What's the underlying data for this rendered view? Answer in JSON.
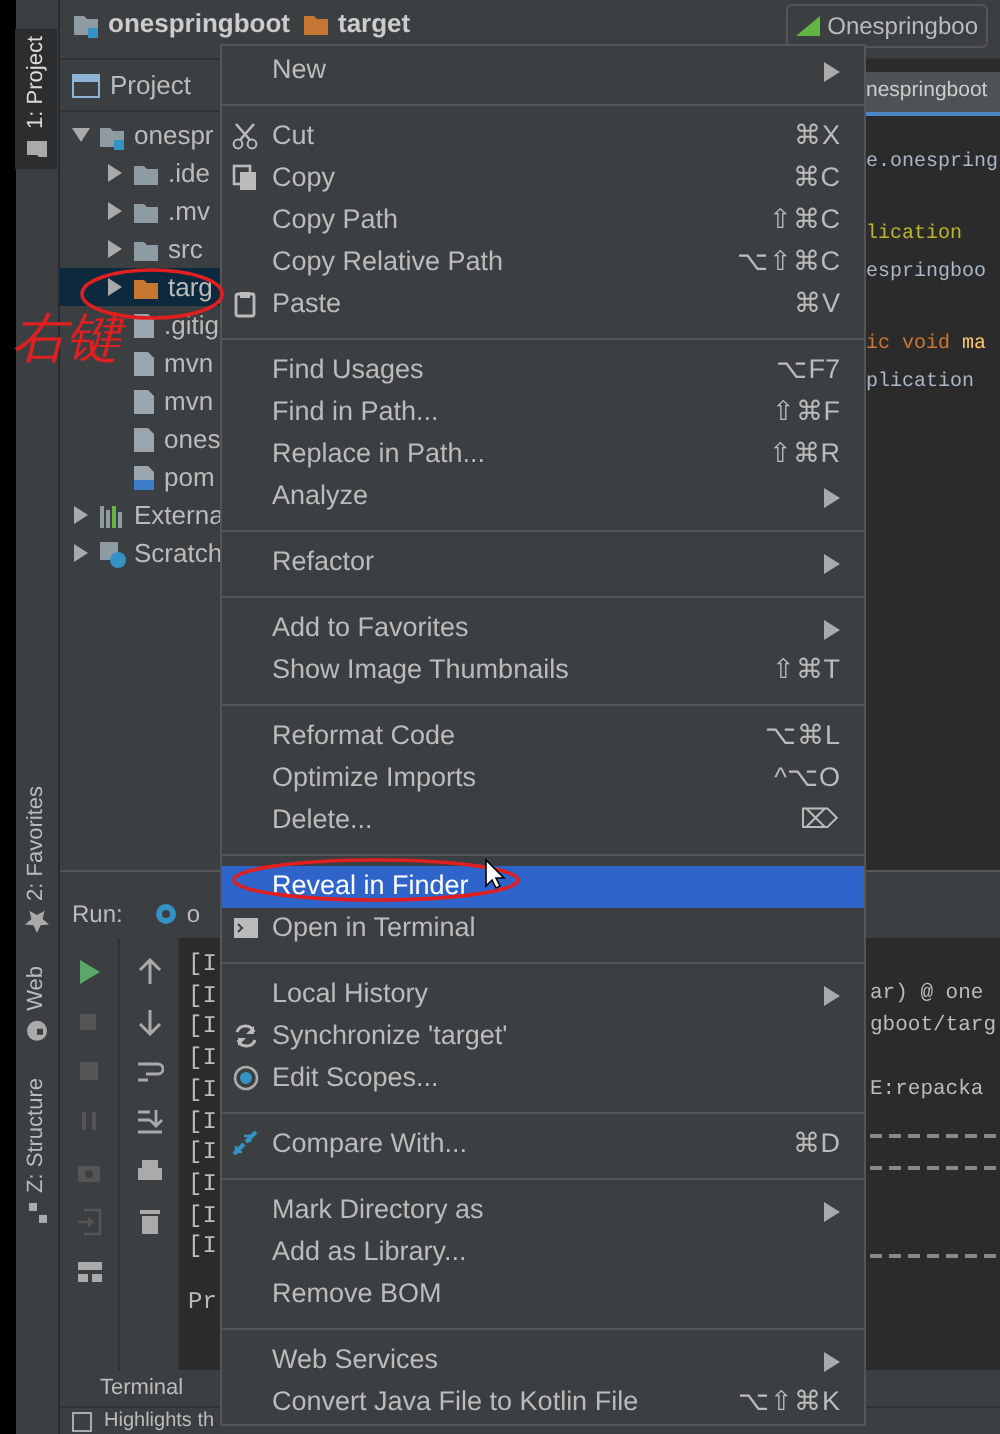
{
  "breadcrumb": {
    "items": [
      {
        "label": "onespringboot",
        "kind": "module"
      },
      {
        "label": "target",
        "kind": "folder"
      }
    ],
    "run_config": "Onespringboo"
  },
  "tool_strip": [
    {
      "label": "1: Project",
      "kind": "folder",
      "selected": true
    },
    {
      "label": "2: Favorites",
      "kind": "star",
      "selected": false
    },
    {
      "label": "Web",
      "kind": "globe",
      "selected": false
    },
    {
      "label": "Z: Structure",
      "kind": "structure",
      "selected": false
    }
  ],
  "project": {
    "title": "Project",
    "tree": [
      {
        "label": "onespr",
        "kind": "module",
        "expanded": true,
        "selected": false,
        "children": [
          {
            "label": ".ide",
            "kind": "folder",
            "expanded": false,
            "selected": false
          },
          {
            "label": ".mv",
            "kind": "folder",
            "expanded": false,
            "selected": false
          },
          {
            "label": "src",
            "kind": "folder",
            "expanded": false,
            "selected": false
          },
          {
            "label": "targ",
            "kind": "excluded",
            "expanded": false,
            "selected": true
          },
          {
            "label": ".gitig",
            "kind": "file",
            "selected": false
          },
          {
            "label": "mvn",
            "kind": "file",
            "selected": false
          },
          {
            "label": "mvn",
            "kind": "file",
            "selected": false
          },
          {
            "label": "ones",
            "kind": "file",
            "selected": false
          },
          {
            "label": "pom",
            "kind": "maven",
            "selected": false
          }
        ]
      },
      {
        "label": "Externa",
        "kind": "library",
        "expanded": false,
        "selected": false
      },
      {
        "label": "Scratch",
        "kind": "scratch",
        "expanded": false,
        "selected": false
      }
    ]
  },
  "editor": {
    "tab": "nespringboot",
    "code_blocks": [
      [
        [
          {
            "text": "e.onespring",
            "kind": "plain"
          }
        ]
      ],
      [
        [
          {
            "text": "lication",
            "kind": "annotation"
          }
        ],
        [
          {
            "text": "espringboo",
            "kind": "plain"
          }
        ]
      ],
      [
        [
          {
            "text": "ic void ",
            "kind": "keyword"
          },
          {
            "text": "ma",
            "kind": "method"
          }
        ],
        [
          {
            "text": "plication",
            "kind": "plain"
          }
        ]
      ]
    ]
  },
  "run": {
    "label": "Run:",
    "config": "o",
    "log_lines": [
      "[I",
      "[I",
      "[I",
      "[I",
      "[I",
      "[I",
      "[I",
      "[I",
      "[I",
      "[I"
    ],
    "prompt": "Pr",
    "output": [
      "ar) @ one",
      "gboot/targ",
      "E:repacka"
    ]
  },
  "bottom_tab": "Terminal",
  "status_bar": "Highlights th",
  "annotation": {
    "handwriting": "右键"
  },
  "menu": [
    [
      {
        "label": "New",
        "submenu": true,
        "selected": false
      }
    ],
    [
      {
        "label": "Cut",
        "kind": "cut",
        "shortcut": "⌘X",
        "selected": false
      },
      {
        "label": "Copy",
        "kind": "copy",
        "shortcut": "⌘C",
        "selected": false
      },
      {
        "label": "Copy Path",
        "shortcut": "⇧⌘C",
        "selected": false
      },
      {
        "label": "Copy Relative Path",
        "shortcut": "⌥⇧⌘C",
        "selected": false
      },
      {
        "label": "Paste",
        "kind": "paste",
        "shortcut": "⌘V",
        "selected": false
      }
    ],
    [
      {
        "label": "Find Usages",
        "shortcut": "⌥F7",
        "selected": false
      },
      {
        "label": "Find in Path...",
        "shortcut": "⇧⌘F",
        "selected": false
      },
      {
        "label": "Replace in Path...",
        "shortcut": "⇧⌘R",
        "selected": false
      },
      {
        "label": "Analyze",
        "submenu": true,
        "selected": false
      }
    ],
    [
      {
        "label": "Refactor",
        "submenu": true,
        "selected": false
      }
    ],
    [
      {
        "label": "Add to Favorites",
        "submenu": true,
        "selected": false
      },
      {
        "label": "Show Image Thumbnails",
        "shortcut": "⇧⌘T",
        "selected": false
      }
    ],
    [
      {
        "label": "Reformat Code",
        "shortcut": "⌥⌘L",
        "selected": false
      },
      {
        "label": "Optimize Imports",
        "shortcut": "^⌥O",
        "selected": false
      },
      {
        "label": "Delete...",
        "shortcut": "⌦",
        "selected": false
      }
    ],
    [
      {
        "label": "Reveal in Finder",
        "selected": true
      },
      {
        "label": "Open in Terminal",
        "kind": "terminal",
        "selected": false
      }
    ],
    [
      {
        "label": "Local History",
        "submenu": true,
        "selected": false
      },
      {
        "label": "Synchronize 'target'",
        "kind": "sync",
        "selected": false
      },
      {
        "label": "Edit Scopes...",
        "kind": "scopes",
        "selected": false
      }
    ],
    [
      {
        "label": "Compare With...",
        "kind": "compare",
        "shortcut": "⌘D",
        "selected": false
      }
    ],
    [
      {
        "label": "Mark Directory as",
        "submenu": true,
        "selected": false
      },
      {
        "label": "Add as Library...",
        "selected": false
      },
      {
        "label": "Remove BOM",
        "selected": false
      }
    ],
    [
      {
        "label": "Web Services",
        "submenu": true,
        "selected": false
      },
      {
        "label": "Convert Java File to Kotlin File",
        "shortcut": "⌥⇧⌘K",
        "selected": false
      }
    ]
  ]
}
